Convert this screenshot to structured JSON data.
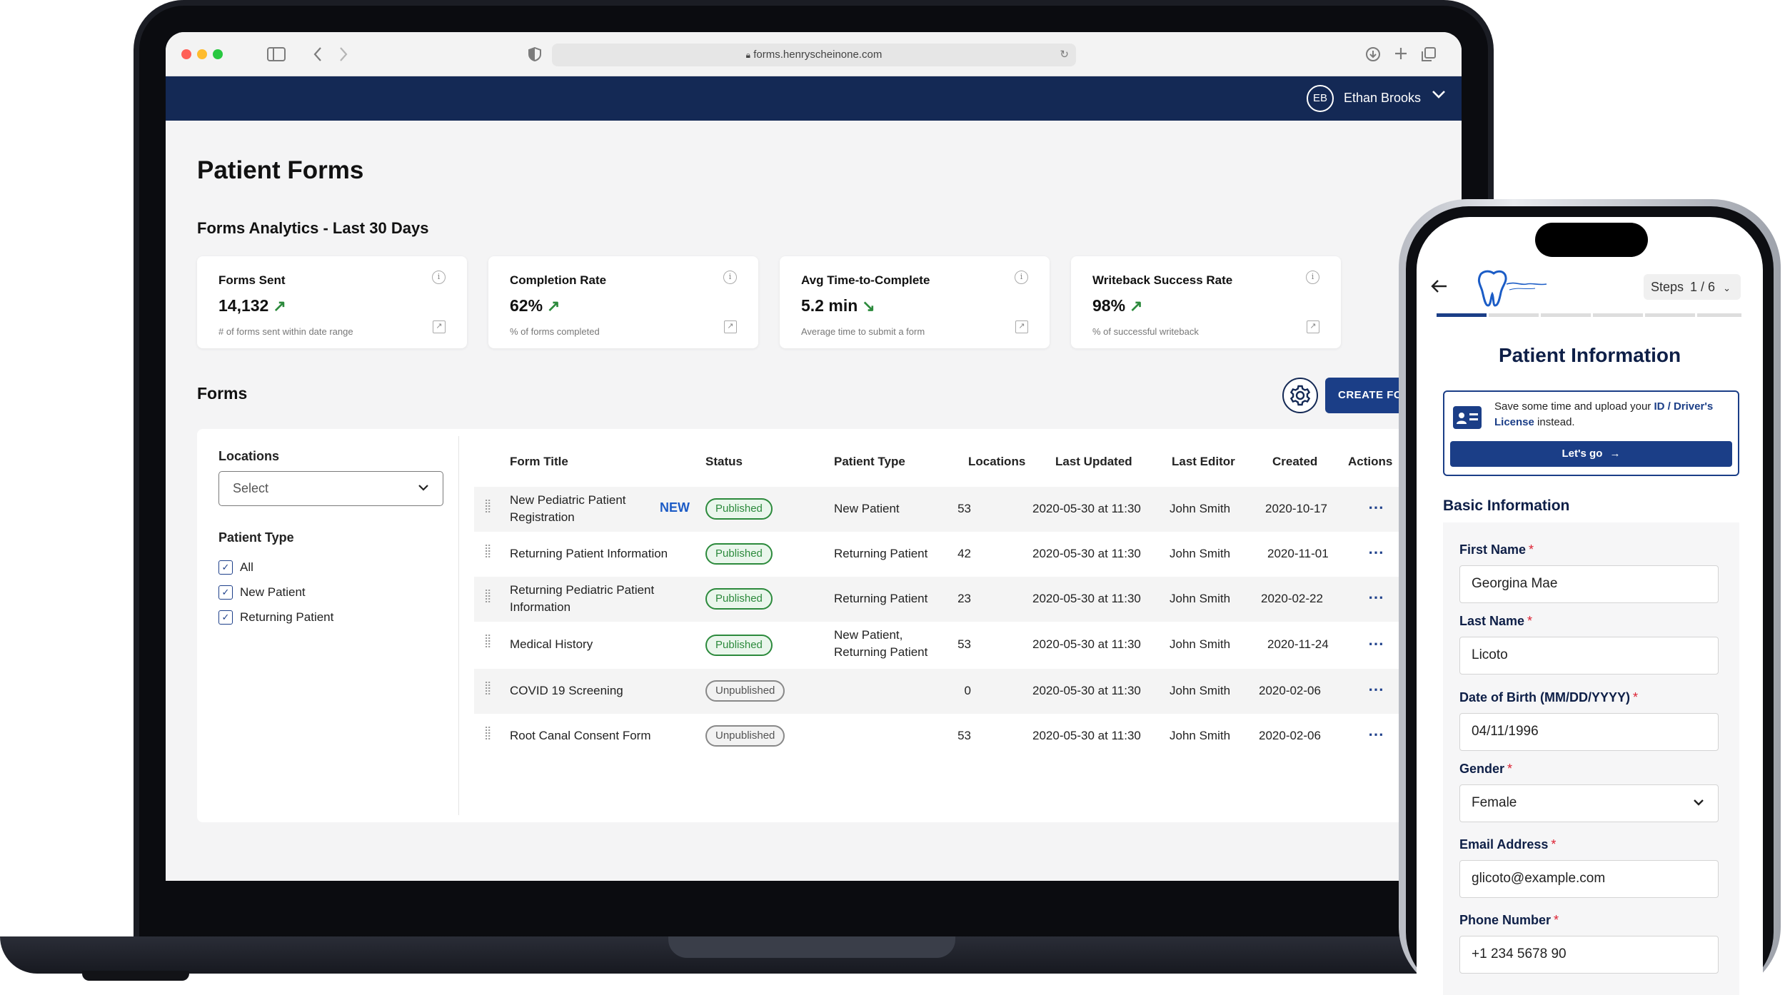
{
  "browser": {
    "url": "forms.henryscheinone.com"
  },
  "colors": {
    "navy": "#142955",
    "primary": "#1b3e87",
    "success": "#2c8a3c"
  },
  "user": {
    "initials": "EB",
    "name": "Ethan Brooks"
  },
  "page": {
    "title": "Patient Forms"
  },
  "analytics": {
    "heading": "Forms Analytics - Last 30 Days",
    "cards": [
      {
        "title": "Forms Sent",
        "value": "14,132",
        "trend": "up",
        "desc": "# of forms sent within date range"
      },
      {
        "title": "Completion Rate",
        "value": "62%",
        "trend": "up",
        "desc": "% of forms  completed"
      },
      {
        "title": "Avg Time-to-Complete",
        "value": "5.2 min",
        "trend": "down",
        "desc": "Average time to submit a form"
      },
      {
        "title": "Writeback Success Rate",
        "value": "98%",
        "trend": "up",
        "desc": "% of successful writeback"
      }
    ]
  },
  "forms": {
    "heading": "Forms",
    "create_label": "CREATE FORM",
    "filters": {
      "locations_label": "Locations",
      "locations_value": "Select",
      "patient_type_label": "Patient Type",
      "options": [
        "All",
        "New Patient",
        "Returning Patient"
      ]
    },
    "columns": [
      "Form Title",
      "Status",
      "Patient Type",
      "Locations",
      "Last Updated",
      "Last Editor",
      "Created",
      "Actions"
    ],
    "new_label": "NEW",
    "rows": [
      {
        "title": "New Pediatric Patient Registration",
        "is_new": true,
        "status": "Published",
        "patient_type": "New Patient",
        "locations": "53",
        "updated": "2020-05-30 at 11:30",
        "editor": "John Smith",
        "created": "2020-10-17"
      },
      {
        "title": "Returning Patient Information",
        "is_new": false,
        "status": "Published",
        "patient_type": "Returning Patient",
        "locations": "42",
        "updated": "2020-05-30 at 11:30",
        "editor": "John Smith",
        "created": "2020-11-01"
      },
      {
        "title": "Returning Pediatric Patient Information",
        "is_new": false,
        "status": "Published",
        "patient_type": "Returning Patient",
        "locations": "23",
        "updated": "2020-05-30 at 11:30",
        "editor": "John Smith",
        "created": "2020-02-22"
      },
      {
        "title": "Medical History",
        "is_new": false,
        "status": "Published",
        "patient_type": "New Patient, Returning Patient",
        "locations": "53",
        "updated": "2020-05-30 at 11:30",
        "editor": "John Smith",
        "created": "2020-11-24"
      },
      {
        "title": "COVID 19 Screening",
        "is_new": false,
        "status": "Unpublished",
        "patient_type": "",
        "locations": "0",
        "updated": "2020-05-30 at 11:30",
        "editor": "John Smith",
        "created": "2020-02-06"
      },
      {
        "title": "Root Canal Consent Form",
        "is_new": false,
        "status": "Unpublished",
        "patient_type": "",
        "locations": "53",
        "updated": "2020-05-30 at 11:30",
        "editor": "John Smith",
        "created": "2020-02-06"
      }
    ]
  },
  "mobile": {
    "steps_label": "Steps",
    "steps_value": "1 / 6",
    "title": "Patient Information",
    "upload_prefix": "Save some time and upload your ",
    "upload_bold": "ID / Driver's License",
    "upload_suffix": " instead.",
    "lets_go": "Let's go",
    "section": "Basic Information",
    "fields": [
      {
        "label": "First Name",
        "value": "Georgina Mae"
      },
      {
        "label": "Last Name",
        "value": "Licoto"
      },
      {
        "label": "Date of Birth (MM/DD/YYYY)",
        "value": "04/11/1996"
      },
      {
        "label": "Gender",
        "value": "Female"
      },
      {
        "label": "Email Address",
        "value": "glicoto@example.com"
      },
      {
        "label": "Phone Number",
        "value": "+1 234 5678 90"
      }
    ]
  }
}
